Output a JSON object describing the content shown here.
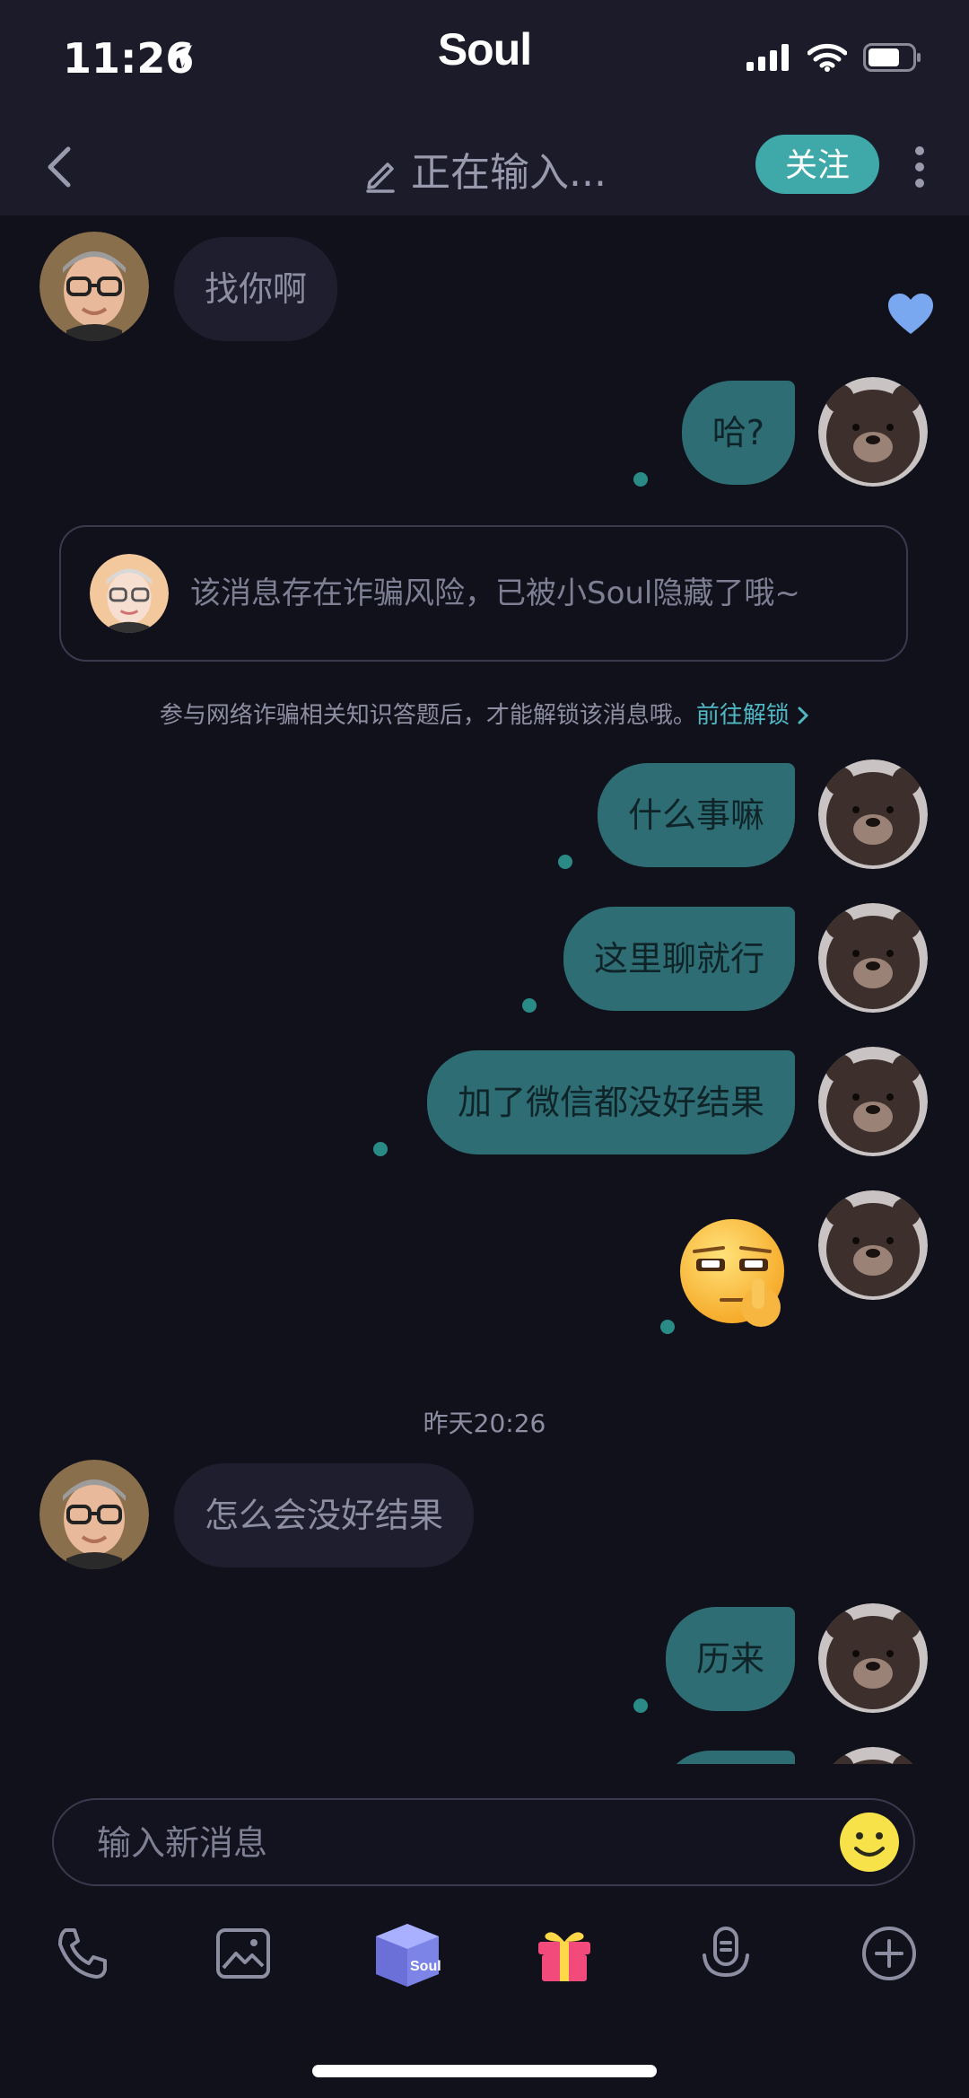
{
  "status_bar": {
    "time": "11:26"
  },
  "app": {
    "brand": "Soul"
  },
  "header": {
    "title": "正在输入...",
    "follow_label": "关注"
  },
  "messages": [
    {
      "side": "in",
      "text": "找你啊"
    },
    {
      "side": "out",
      "text": "哈?"
    },
    {
      "side": "system",
      "text": "该消息存在诈骗风险，已被小Soul隐藏了哦~"
    },
    {
      "side": "out",
      "text": "什么事嘛"
    },
    {
      "side": "out",
      "text": "这里聊就行"
    },
    {
      "side": "out",
      "text": "加了微信都没好结果"
    },
    {
      "side": "out",
      "text": "🤫"
    },
    {
      "side": "in",
      "text": "怎么会没好结果"
    },
    {
      "side": "out",
      "text": "历来"
    }
  ],
  "notice": {
    "text": "参与网络诈骗相关知识答题后，才能解锁该消息哦。",
    "link": "前往解锁"
  },
  "timestamp": "昨天20:26",
  "composer": {
    "placeholder": "输入新消息"
  },
  "colors": {
    "background": "#11111c",
    "bubble_out": "#2d6d73",
    "bubble_in": "#1e1e2e",
    "accent": "#3fa8a8",
    "link": "#4fb8c2"
  }
}
